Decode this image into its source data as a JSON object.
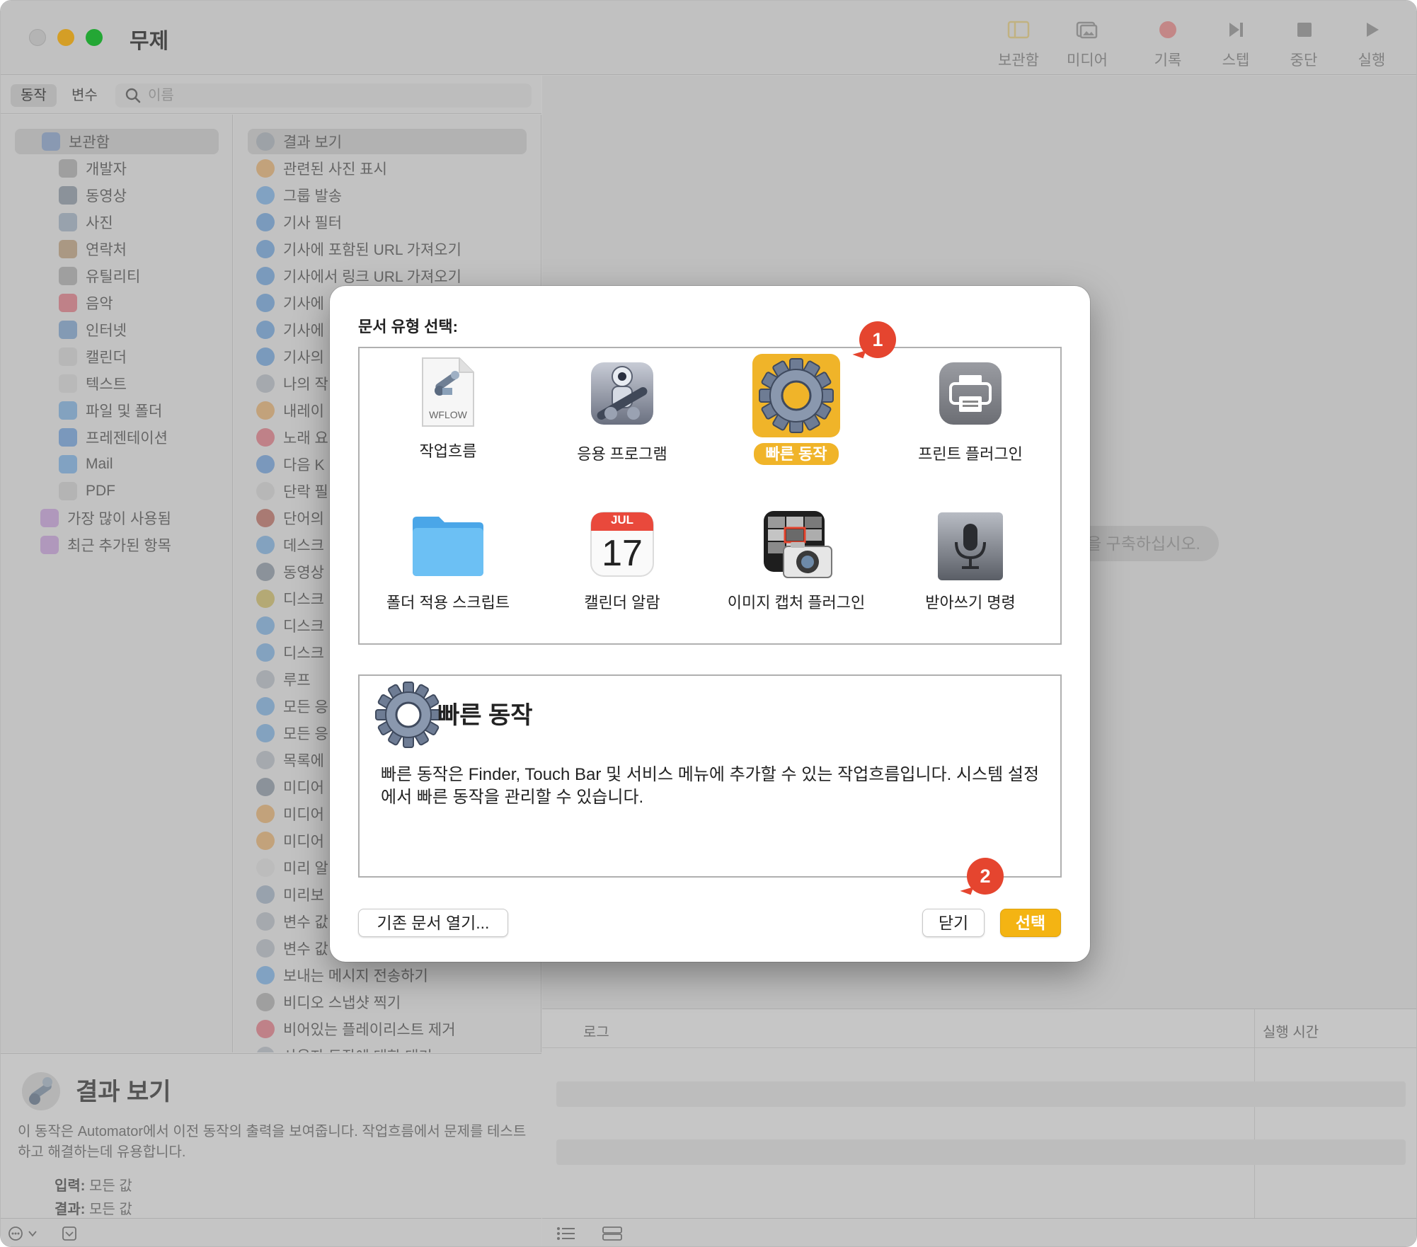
{
  "window": {
    "title": "무제"
  },
  "toolbar": {
    "items": [
      {
        "label": "보관함",
        "icon": "library-icon"
      },
      {
        "label": "미디어",
        "icon": "media-icon"
      },
      {
        "label": "기록",
        "icon": "record-icon"
      },
      {
        "label": "스텝",
        "icon": "step-icon"
      },
      {
        "label": "중단",
        "icon": "stop-icon"
      },
      {
        "label": "실행",
        "icon": "run-icon"
      }
    ]
  },
  "library": {
    "tabs": [
      "동작",
      "변수"
    ],
    "search_placeholder": "이름",
    "categories": [
      {
        "label": "보관함",
        "icon": "library-icon",
        "color": "#7c9fd6"
      },
      {
        "label": "개발자",
        "icon": "tools-icon",
        "color": "#9a9a9a"
      },
      {
        "label": "동영상",
        "icon": "movie-icon",
        "color": "#6f7f90"
      },
      {
        "label": "사진",
        "icon": "photo-icon",
        "color": "#8aa0b8"
      },
      {
        "label": "연락처",
        "icon": "contacts-icon",
        "color": "#b38a5e"
      },
      {
        "label": "유틸리티",
        "icon": "tools-icon",
        "color": "#9a9a9a"
      },
      {
        "label": "음악",
        "icon": "music-icon",
        "color": "#e05a6a"
      },
      {
        "label": "인터넷",
        "icon": "globe-icon",
        "color": "#5c8fc9"
      },
      {
        "label": "캘린더",
        "icon": "calendar-icon",
        "color": "#d0d0d0"
      },
      {
        "label": "텍스트",
        "icon": "text-icon",
        "color": "#d4d4d4"
      },
      {
        "label": "파일 및 폴더",
        "icon": "finder-icon",
        "color": "#5ea0e0"
      },
      {
        "label": "프레젠테이션",
        "icon": "keynote-icon",
        "color": "#4a8ad8"
      },
      {
        "label": "Mail",
        "icon": "mail-icon",
        "color": "#5aa0e6"
      },
      {
        "label": "PDF",
        "icon": "pdf-icon",
        "color": "#c8c8c8"
      },
      {
        "label": "가장 많이 사용됨",
        "icon": "smart-folder-icon",
        "color": "#c08ad8"
      },
      {
        "label": "최근 추가된 항목",
        "icon": "smart-folder-icon",
        "color": "#c08ad8"
      }
    ],
    "actions": [
      {
        "label": "결과 보기",
        "icon": "automator-icon"
      },
      {
        "label": "관련된 사진 표시",
        "icon": "photos-icon"
      },
      {
        "label": "그룹 발송",
        "icon": "mail-icon"
      },
      {
        "label": "기사 필터",
        "icon": "safari-icon"
      },
      {
        "label": "기사에 포함된 URL 가져오기",
        "icon": "safari-icon"
      },
      {
        "label": "기사에서 링크 URL 가져오기",
        "icon": "safari-icon"
      },
      {
        "label": "기사에",
        "icon": "safari-icon"
      },
      {
        "label": "기사에",
        "icon": "safari-icon"
      },
      {
        "label": "기사의",
        "icon": "safari-icon"
      },
      {
        "label": "나의 작",
        "icon": "automator-icon"
      },
      {
        "label": "내레이",
        "icon": "photos-icon"
      },
      {
        "label": "노래 요",
        "icon": "music-icon"
      },
      {
        "label": "다음 K",
        "icon": "keynote-icon"
      },
      {
        "label": "단락 필",
        "icon": "text-icon"
      },
      {
        "label": "단어의",
        "icon": "dictionary-icon"
      },
      {
        "label": "데스크",
        "icon": "finder-icon"
      },
      {
        "label": "동영상",
        "icon": "movie-icon"
      },
      {
        "label": "디스크",
        "icon": "disk-icon"
      },
      {
        "label": "디스크",
        "icon": "finder-icon"
      },
      {
        "label": "디스크",
        "icon": "finder-icon"
      },
      {
        "label": "루프",
        "icon": "automator-icon"
      },
      {
        "label": "모든 응",
        "icon": "finder-icon"
      },
      {
        "label": "모든 응",
        "icon": "finder-icon"
      },
      {
        "label": "목록에",
        "icon": "automator-icon"
      },
      {
        "label": "미디어",
        "icon": "movie-icon"
      },
      {
        "label": "미디어",
        "icon": "photos-icon"
      },
      {
        "label": "미디어",
        "icon": "photos-icon"
      },
      {
        "label": "미리 알",
        "icon": "reminders-icon"
      },
      {
        "label": "미리보",
        "icon": "preview-icon"
      },
      {
        "label": "변수 값",
        "icon": "automator-icon"
      },
      {
        "label": "변수 값",
        "icon": "automator-icon"
      },
      {
        "label": "보내는 메시지 전송하기",
        "icon": "mail-icon"
      },
      {
        "label": "비디오 스냅샷 찍기",
        "icon": "tools-icon"
      },
      {
        "label": "비어있는 플레이리스트 제거",
        "icon": "music-icon"
      },
      {
        "label": "사용자 동작에 대한 대기",
        "icon": "automator-icon"
      }
    ]
  },
  "description": {
    "title": "결과 보기",
    "text": "이 동작은 Automator에서 이전 동작의 출력을 보여줍니다. 작업흐름에서 문제를 테스트하고 해결하는데 유용합니다.",
    "input_label": "입력:",
    "input_value": "모든 값",
    "result_label": "결과:",
    "result_value": "모든 값"
  },
  "workflow": {
    "hint": "을 구축하십시오."
  },
  "log": {
    "col_log": "로그",
    "col_time": "실행 시간"
  },
  "dialog": {
    "heading": "문서 유형 선택:",
    "types": [
      {
        "label": "작업흐름",
        "icon": "workflow-file-icon",
        "selected": false
      },
      {
        "label": "응용 프로그램",
        "icon": "automator-robot-icon",
        "selected": false
      },
      {
        "label": "빠른 동작",
        "icon": "gear-icon",
        "selected": true
      },
      {
        "label": "프린트 플러그인",
        "icon": "printer-icon",
        "selected": false
      },
      {
        "label": "폴더 적용 스크립트",
        "icon": "folder-icon",
        "selected": false
      },
      {
        "label": "캘린더 알람",
        "icon": "calendar-icon",
        "selected": false
      },
      {
        "label": "이미지 캡처 플러그인",
        "icon": "image-capture-icon",
        "selected": false
      },
      {
        "label": "받아쓰기 명령",
        "icon": "microphone-icon",
        "selected": false
      }
    ],
    "workflow_file_label": "WFLOW",
    "calendar_month": "JUL",
    "calendar_day": "17",
    "detail_title": "빠른 동작",
    "detail_text": "빠른 동작은 Finder, Touch Bar 및 서비스 메뉴에 추가할 수 있는 작업흐름입니다. 시스템 설정에서 빠른 동작을 관리할 수 있습니다.",
    "open_existing": "기존 문서 열기...",
    "close": "닫기",
    "choose": "선택",
    "callout_1": "1",
    "callout_2": "2"
  },
  "colors": {
    "accent": "#f4b413",
    "callout": "#e5452f"
  }
}
